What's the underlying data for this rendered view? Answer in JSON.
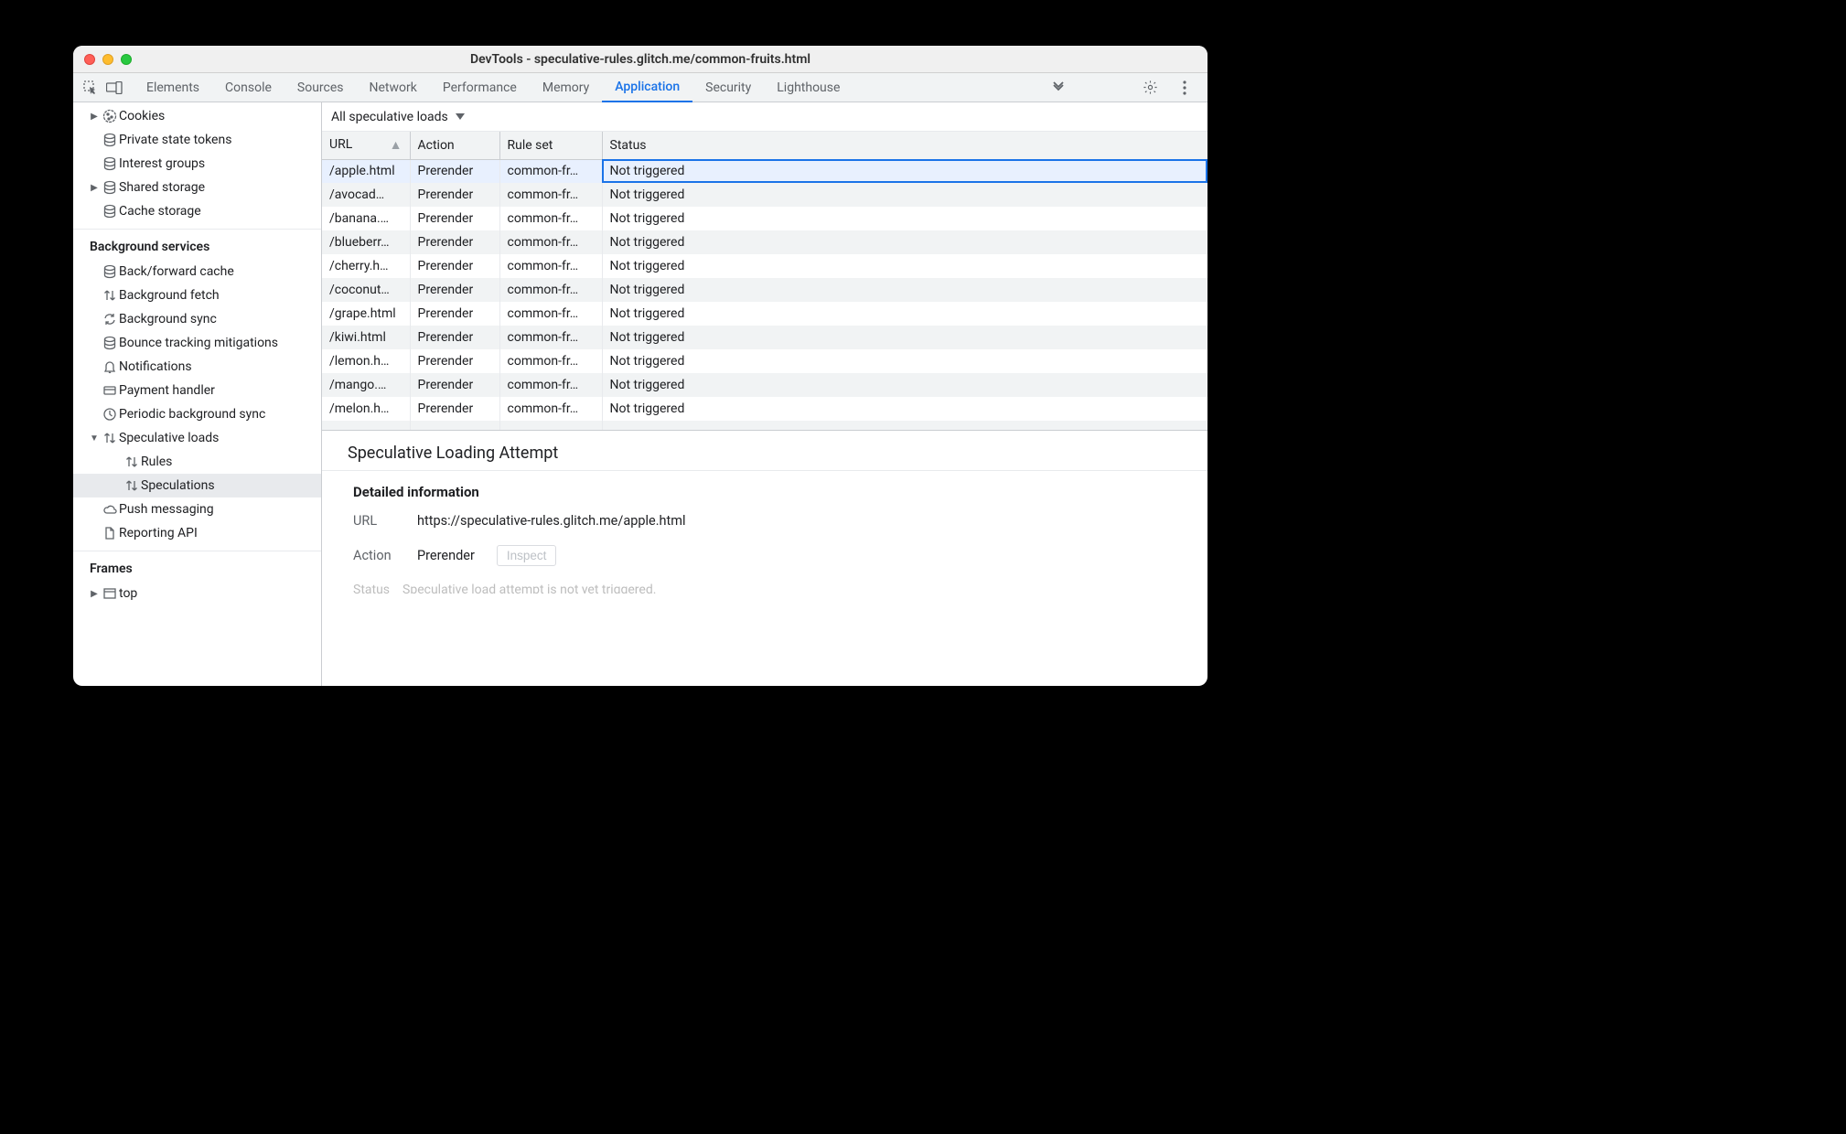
{
  "window": {
    "title": "DevTools - speculative-rules.glitch.me/common-fruits.html"
  },
  "tabs": {
    "items": [
      "Elements",
      "Console",
      "Sources",
      "Network",
      "Performance",
      "Memory",
      "Application",
      "Security",
      "Lighthouse"
    ],
    "active": "Application"
  },
  "sidebar": {
    "top_items": [
      {
        "icon": "cookie-icon",
        "label": "Cookies",
        "arrow": true
      },
      {
        "icon": "database-icon",
        "label": "Private state tokens"
      },
      {
        "icon": "database-icon",
        "label": "Interest groups"
      },
      {
        "icon": "database-icon",
        "label": "Shared storage",
        "arrow": true
      },
      {
        "icon": "database-icon",
        "label": "Cache storage"
      }
    ],
    "section_bg": "Background services",
    "bg_items": [
      {
        "icon": "database-icon",
        "label": "Back/forward cache"
      },
      {
        "icon": "updown-icon",
        "label": "Background fetch"
      },
      {
        "icon": "sync-icon",
        "label": "Background sync"
      },
      {
        "icon": "database-icon",
        "label": "Bounce tracking mitigations"
      },
      {
        "icon": "bell-icon",
        "label": "Notifications"
      },
      {
        "icon": "card-icon",
        "label": "Payment handler"
      },
      {
        "icon": "clock-icon",
        "label": "Periodic background sync"
      }
    ],
    "spec": {
      "label": "Speculative loads",
      "rules": "Rules",
      "speculations": "Speculations"
    },
    "after_spec": [
      {
        "icon": "cloud-icon",
        "label": "Push messaging"
      },
      {
        "icon": "file-icon",
        "label": "Reporting API"
      }
    ],
    "section_frames": "Frames",
    "frames_item": {
      "label": "top"
    }
  },
  "toolbar2": {
    "dropdown": "All speculative loads"
  },
  "table": {
    "columns": [
      "URL",
      "Action",
      "Rule set",
      "Status"
    ],
    "rows": [
      {
        "url": "/apple.html",
        "action": "Prerender",
        "ruleset": "common-fr…",
        "status": "Not triggered",
        "selected": true
      },
      {
        "url": "/avocad…",
        "action": "Prerender",
        "ruleset": "common-fr…",
        "status": "Not triggered"
      },
      {
        "url": "/banana.…",
        "action": "Prerender",
        "ruleset": "common-fr…",
        "status": "Not triggered"
      },
      {
        "url": "/blueberr…",
        "action": "Prerender",
        "ruleset": "common-fr…",
        "status": "Not triggered"
      },
      {
        "url": "/cherry.h…",
        "action": "Prerender",
        "ruleset": "common-fr…",
        "status": "Not triggered"
      },
      {
        "url": "/coconut…",
        "action": "Prerender",
        "ruleset": "common-fr…",
        "status": "Not triggered"
      },
      {
        "url": "/grape.html",
        "action": "Prerender",
        "ruleset": "common-fr…",
        "status": "Not triggered"
      },
      {
        "url": "/kiwi.html",
        "action": "Prerender",
        "ruleset": "common-fr…",
        "status": "Not triggered"
      },
      {
        "url": "/lemon.h…",
        "action": "Prerender",
        "ruleset": "common-fr…",
        "status": "Not triggered"
      },
      {
        "url": "/mango.…",
        "action": "Prerender",
        "ruleset": "common-fr…",
        "status": "Not triggered"
      },
      {
        "url": "/melon.h…",
        "action": "Prerender",
        "ruleset": "common-fr…",
        "status": "Not triggered"
      }
    ]
  },
  "detail": {
    "heading": "Speculative Loading Attempt",
    "section_title": "Detailed information",
    "url_label": "URL",
    "url_value": "https://speculative-rules.glitch.me/apple.html",
    "action_label": "Action",
    "action_value": "Prerender",
    "inspect_label": "Inspect",
    "status_label": "Status",
    "status_value": "Speculative load attempt is not yet triggered."
  }
}
